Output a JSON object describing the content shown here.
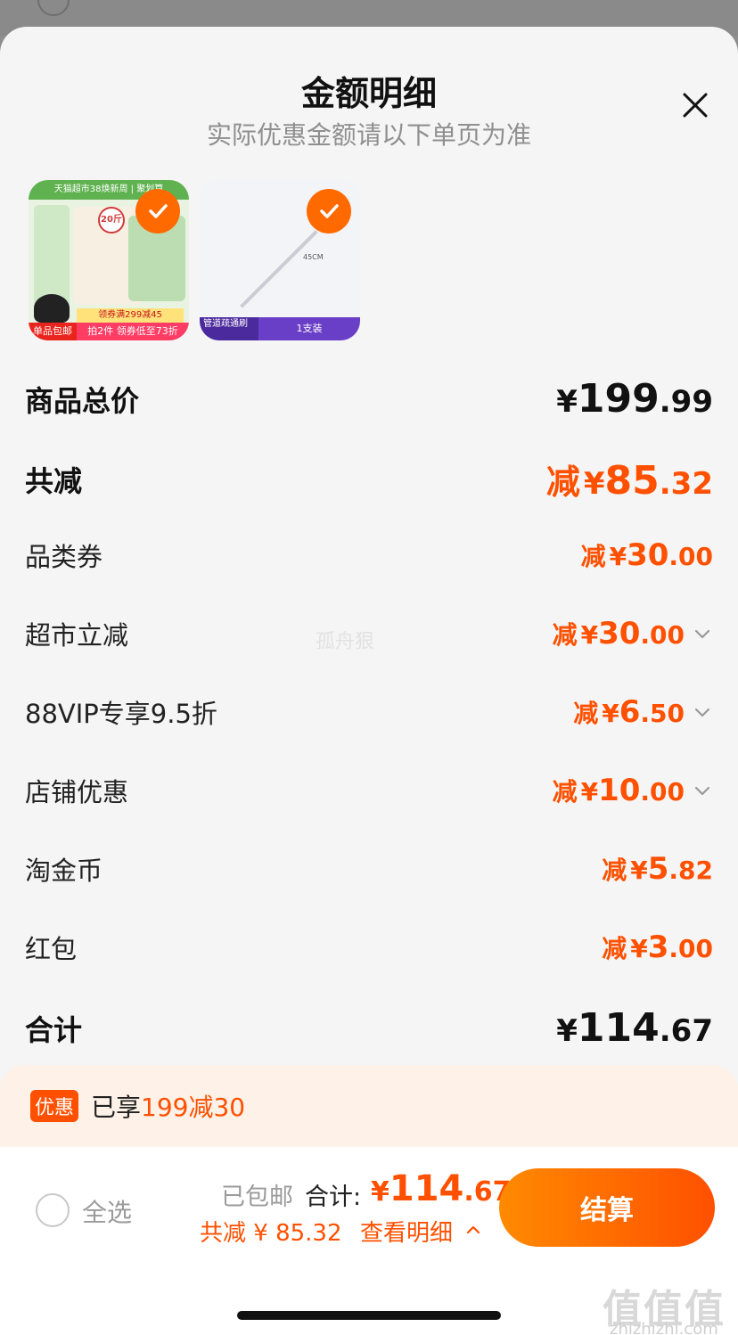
{
  "header": {
    "title": "金额明细",
    "subtitle": "实际优惠金额请以下单页为准"
  },
  "products": [
    {
      "band": "天猫超市38焕新周 | 聚划算",
      "weight": "20斤",
      "promo1": "领券满299减45",
      "promo2": "拍2件 领券低至73折",
      "flag": "单品包邮",
      "icon": "dog-food-bag",
      "checked": true
    },
    {
      "length": "45CM",
      "tag": "管道疏通刷",
      "qty": "1支装",
      "icon": "pipe-brush",
      "checked": true
    }
  ],
  "rows": [
    {
      "label": "商品总价",
      "prefix": "",
      "yen": "¥",
      "int": "199",
      "dec": ".99",
      "style": "total"
    },
    {
      "label": "共减",
      "prefix": "减",
      "yen": "¥",
      "int": "85",
      "dec": ".32",
      "style": "big"
    },
    {
      "label": "品类券",
      "prefix": "减",
      "yen": "¥",
      "int": "30",
      "dec": ".00",
      "style": "normal"
    },
    {
      "label": "超市立减",
      "prefix": "减",
      "yen": "¥",
      "int": "30",
      "dec": ".00",
      "style": "normal",
      "expand": true
    },
    {
      "label": "88VIP专享9.5折",
      "prefix": "减",
      "yen": "¥",
      "int": "6",
      "dec": ".50",
      "style": "normal",
      "expand": true
    },
    {
      "label": "店铺优惠",
      "prefix": "减",
      "yen": "¥",
      "int": "10",
      "dec": ".00",
      "style": "normal",
      "expand": true
    },
    {
      "label": "淘金币",
      "prefix": "减",
      "yen": "¥",
      "int": "5",
      "dec": ".82",
      "style": "normal"
    },
    {
      "label": "红包",
      "prefix": "减",
      "yen": "¥",
      "int": "3",
      "dec": ".00",
      "style": "normal"
    },
    {
      "label": "合计",
      "prefix": "",
      "yen": "¥",
      "int": "114",
      "dec": ".67",
      "style": "total"
    }
  ],
  "watermark": "孤舟狠",
  "promo": {
    "badge": "优惠",
    "text": "已享",
    "highlight": "199减30"
  },
  "footer": {
    "select_all": "全选",
    "shipping": "已包邮",
    "total_label": "合计:",
    "total_yen": "¥",
    "total_int": "114",
    "total_dec": ".67",
    "saved": "共减 ¥ 85.32",
    "detail": "查看明细",
    "checkout": "结算"
  },
  "site_watermark": {
    "logo": "值值值",
    "url": "zhizhizhi.com"
  },
  "colors": {
    "accent": "#ff5000",
    "accent_light": "#ff8a00",
    "sheet_bg": "#f5f5f5",
    "promo_bg": "#fdf1e8"
  }
}
